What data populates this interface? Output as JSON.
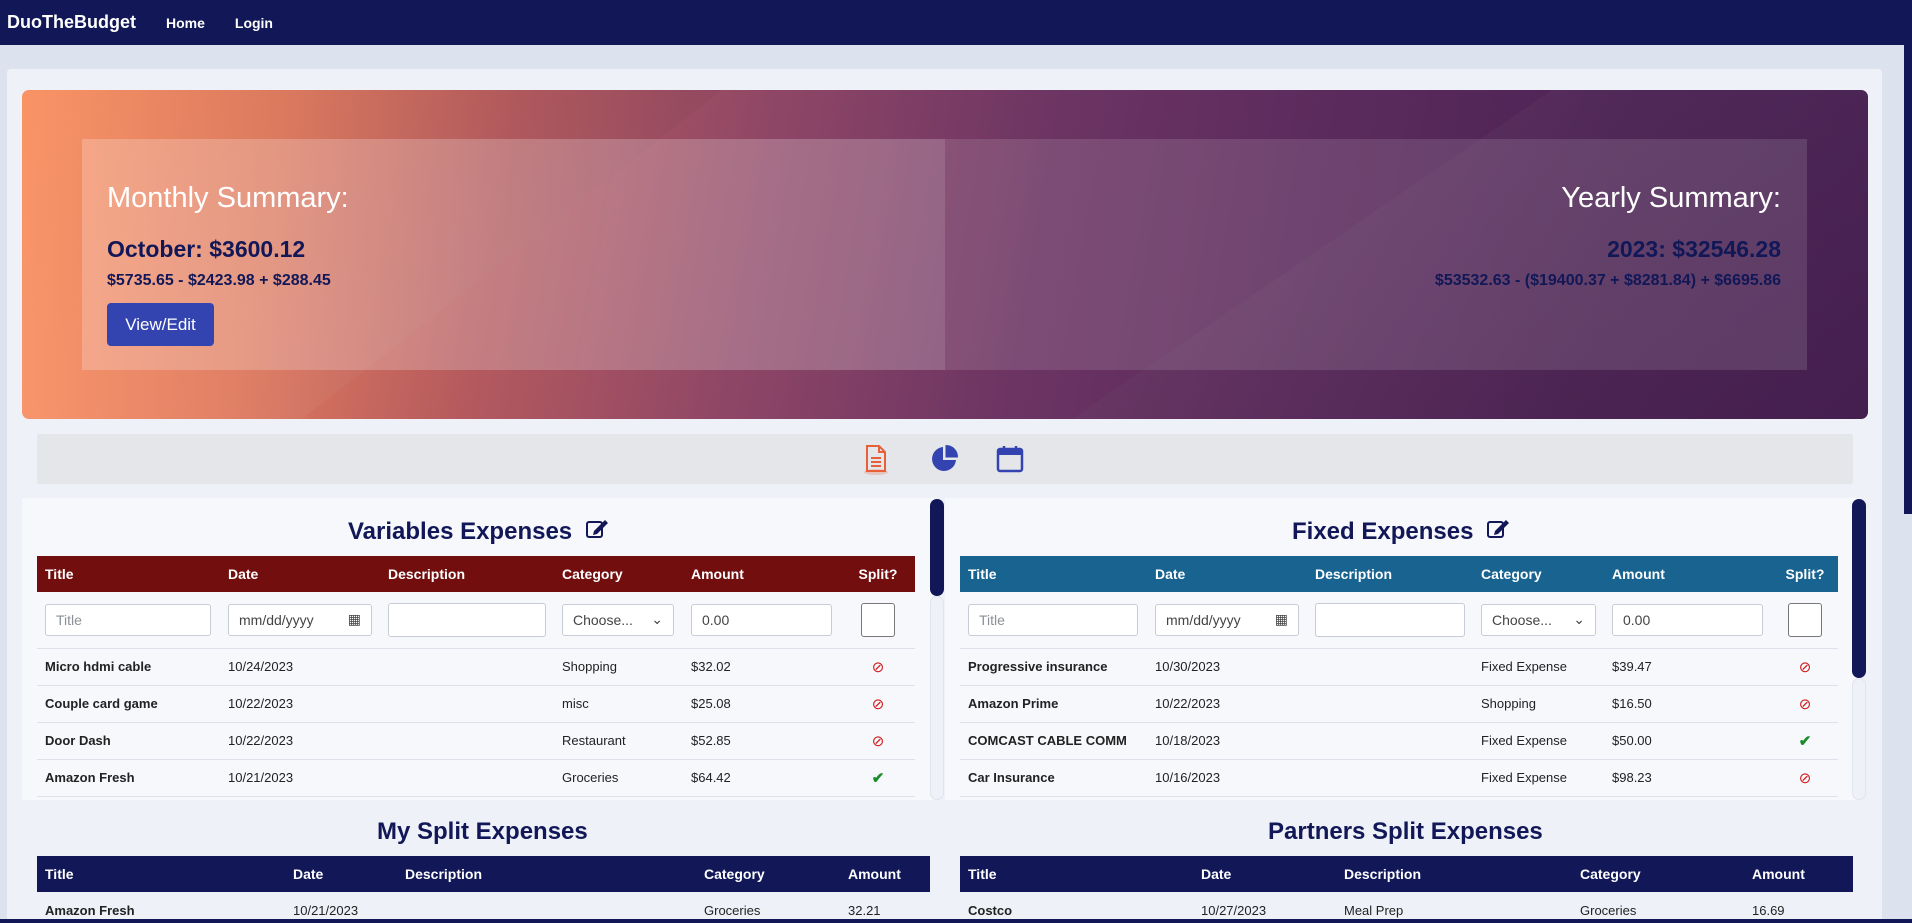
{
  "navbar": {
    "brand": "DuoTheBudget",
    "links": [
      "Home",
      "Login"
    ]
  },
  "monthly": {
    "title": "Monthly Summary:",
    "total": "October: $3600.12",
    "formula": "$5735.65 - $2423.98 + $288.45",
    "button": "View/Edit"
  },
  "yearly": {
    "title": "Yearly Summary:",
    "total": "2023: $32546.28",
    "formula": "$53532.63 - ($19400.37 + $8281.84) + $6695.86"
  },
  "tabs": [
    {
      "icon": "document-icon",
      "active": true,
      "color": "#e8603a"
    },
    {
      "icon": "pie-chart-icon",
      "active": false,
      "color": "#3344b0"
    },
    {
      "icon": "calendar-icon",
      "active": false,
      "color": "#3344b0"
    }
  ],
  "variable": {
    "title": "Variables Expenses",
    "columns": [
      "Title",
      "Date",
      "Description",
      "Category",
      "Amount",
      "Split?"
    ],
    "form": {
      "title_placeholder": "Title",
      "date_placeholder": "mm/dd/yyyy",
      "category_placeholder": "Choose...",
      "amount_placeholder": "0.00"
    },
    "rows": [
      {
        "title": "Micro hdmi cable",
        "date": "10/24/2023",
        "description": "",
        "category": "Shopping",
        "amount": "$32.02",
        "split": false
      },
      {
        "title": "Couple card game",
        "date": "10/22/2023",
        "description": "",
        "category": "misc",
        "amount": "$25.08",
        "split": false
      },
      {
        "title": "Door Dash",
        "date": "10/22/2023",
        "description": "",
        "category": "Restaurant",
        "amount": "$52.85",
        "split": false
      },
      {
        "title": "Amazon Fresh",
        "date": "10/21/2023",
        "description": "",
        "category": "Groceries",
        "amount": "$64.42",
        "split": true
      }
    ]
  },
  "fixed": {
    "title": "Fixed Expenses",
    "columns": [
      "Title",
      "Date",
      "Description",
      "Category",
      "Amount",
      "Split?"
    ],
    "form": {
      "title_placeholder": "Title",
      "date_placeholder": "mm/dd/yyyy",
      "category_placeholder": "Choose...",
      "amount_placeholder": "0.00"
    },
    "rows": [
      {
        "title": "Progressive insurance",
        "date": "10/30/2023",
        "description": "",
        "category": "Fixed Expense",
        "amount": "$39.47",
        "split": false
      },
      {
        "title": "Amazon Prime",
        "date": "10/22/2023",
        "description": "",
        "category": "Shopping",
        "amount": "$16.50",
        "split": false
      },
      {
        "title": "COMCAST CABLE COMM",
        "date": "10/18/2023",
        "description": "",
        "category": "Fixed Expense",
        "amount": "$50.00",
        "split": true
      },
      {
        "title": "Car Insurance",
        "date": "10/16/2023",
        "description": "",
        "category": "Fixed Expense",
        "amount": "$98.23",
        "split": false
      }
    ]
  },
  "my_split": {
    "title": "My Split Expenses",
    "columns": [
      "Title",
      "Date",
      "Description",
      "Category",
      "Amount"
    ],
    "rows": [
      {
        "title": "Amazon Fresh",
        "date": "10/21/2023",
        "description": "",
        "category": "Groceries",
        "amount": "32.21"
      }
    ]
  },
  "partner_split": {
    "title": "Partners Split Expenses",
    "columns": [
      "Title",
      "Date",
      "Description",
      "Category",
      "Amount"
    ],
    "rows": [
      {
        "title": "Costco",
        "date": "10/27/2023",
        "description": "Meal Prep",
        "category": "Groceries",
        "amount": "16.69"
      }
    ]
  },
  "colors": {
    "navy": "#111757",
    "variable_header": "#720e0e",
    "fixed_header": "#186390",
    "accent_button": "#3344b0"
  }
}
